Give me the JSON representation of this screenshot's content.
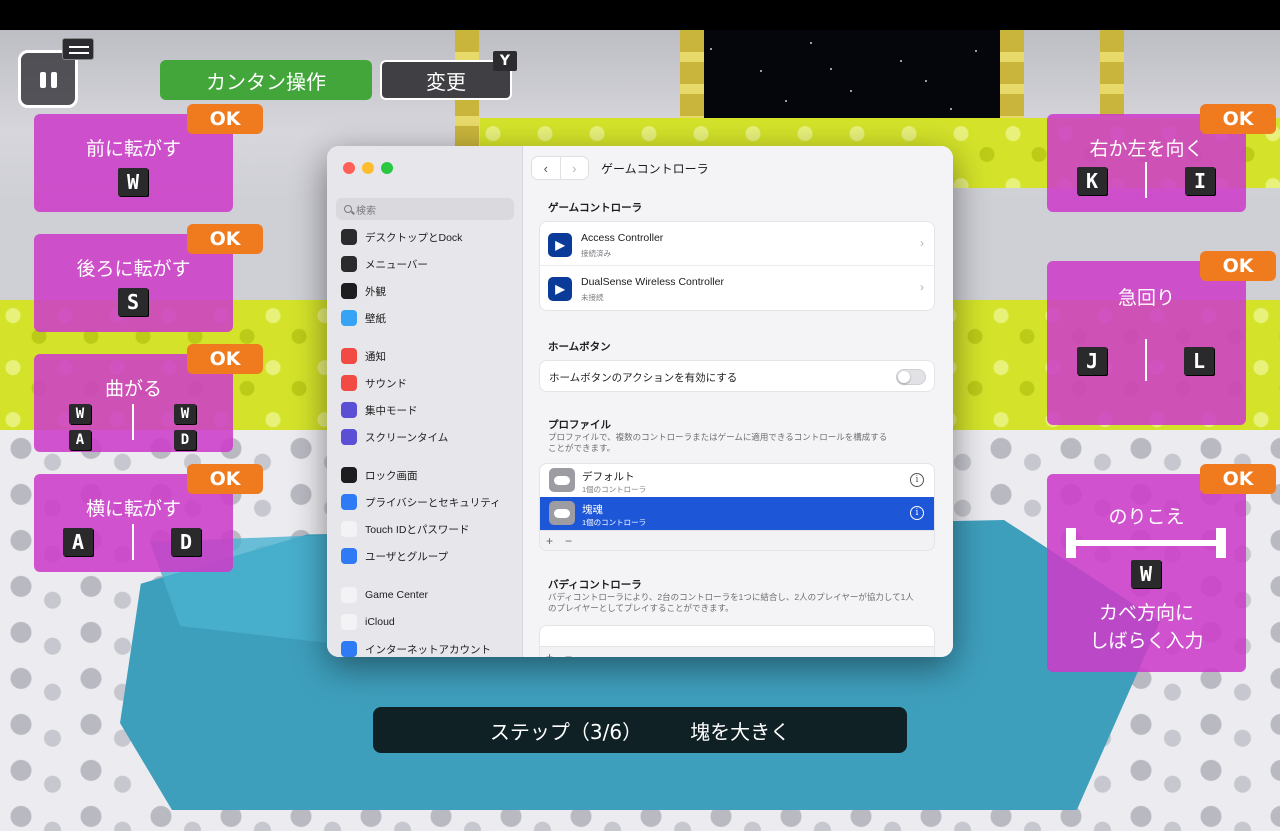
{
  "hud": {
    "easy_mode_label": "カンタン操作",
    "change_label": "変更",
    "change_key": "Y"
  },
  "cards": {
    "forward": {
      "title": "前に転がす",
      "ok": "OK",
      "key": "W"
    },
    "backward": {
      "title": "後ろに転がす",
      "ok": "OK",
      "key": "S"
    },
    "turn": {
      "title": "曲がる",
      "ok": "OK",
      "keys": [
        "W",
        "A",
        "W",
        "D"
      ]
    },
    "sideways": {
      "title": "横に転がす",
      "ok": "OK",
      "keys": [
        "A",
        "D"
      ]
    },
    "look": {
      "title": "右か左を向く",
      "ok": "OK",
      "keys": [
        "K",
        "I"
      ]
    },
    "quick_turn": {
      "title": "急回り",
      "ok": "OK",
      "keys": [
        "J",
        "L"
      ]
    },
    "climb": {
      "title": "のりこえ",
      "ok": "OK",
      "key": "W",
      "line1": "カベ方向に",
      "line2": "しばらく入力"
    }
  },
  "step": {
    "label": "ステップ（3/6）",
    "task": "塊を大きく"
  },
  "settings": {
    "search_placeholder": "検索",
    "sidebar_items": [
      {
        "label": "デスクトップとDock",
        "icon": "dock-icon",
        "color": "#2b2b2e"
      },
      {
        "label": "メニューバー",
        "icon": "menubar-icon",
        "color": "#2b2b2e"
      },
      {
        "label": "外観",
        "icon": "appearance-icon",
        "color": "#1d1d1f"
      },
      {
        "label": "壁紙",
        "icon": "wallpaper-icon",
        "color": "#36a3f5"
      },
      {
        "label": "通知",
        "icon": "notification-icon",
        "color": "#f24b43"
      },
      {
        "label": "サウンド",
        "icon": "sound-icon",
        "color": "#f24b43"
      },
      {
        "label": "集中モード",
        "icon": "focus-icon",
        "color": "#5b4fd6"
      },
      {
        "label": "スクリーンタイム",
        "icon": "screentime-icon",
        "color": "#5b4fd6"
      },
      {
        "label": "ロック画面",
        "icon": "lock-icon",
        "color": "#1d1d1f"
      },
      {
        "label": "プライバシーとセキュリティ",
        "icon": "hand-icon",
        "color": "#2f7af5"
      },
      {
        "label": "Touch IDとパスワード",
        "icon": "fingerprint-icon",
        "color": "#f3f3f5"
      },
      {
        "label": "ユーザとグループ",
        "icon": "users-icon",
        "color": "#2f7af5"
      },
      {
        "label": "Game Center",
        "icon": "gamecenter-icon",
        "color": "#f3f3f5"
      },
      {
        "label": "iCloud",
        "icon": "icloud-icon",
        "color": "#f3f3f5"
      },
      {
        "label": "インターネットアカウント",
        "icon": "at-icon",
        "color": "#2f7af5"
      }
    ],
    "title": "ゲームコントローラ",
    "controllers_header": "ゲームコントローラ",
    "controllers": [
      {
        "name": "Access Controller",
        "status": "接続済み"
      },
      {
        "name": "DualSense Wireless Controller",
        "status": "未接続"
      }
    ],
    "home_header": "ホームボタン",
    "home_toggle_label": "ホームボタンのアクションを有効にする",
    "home_toggle_on": false,
    "profile_header": "プロファイル",
    "profile_desc_1": "プロファイルで、複数のコントローラまたはゲームに適用できるコントロールを構成する",
    "profile_desc_2": "ことができます。",
    "profiles": [
      {
        "name": "デフォルト",
        "count": "1個のコントローラ",
        "selected": false
      },
      {
        "name": "塊魂",
        "count": "1個のコントローラ",
        "selected": true
      }
    ],
    "plus": "+",
    "minus": "−",
    "buddy_header": "バディコントローラ",
    "buddy_desc_1": "バディコントローラにより、2台のコントローラを1つに結合し、2人のプレイヤーが協力して1人",
    "buddy_desc_2": "のプレイヤーとしてプレイすることができます。"
  }
}
